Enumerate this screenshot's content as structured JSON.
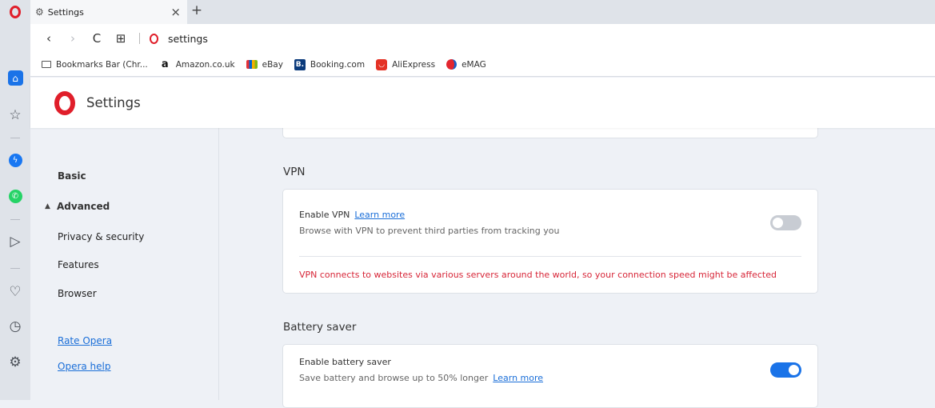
{
  "browser": {
    "tab_title": "Settings",
    "address": "settings",
    "close_glyph": "×",
    "newtab_glyph": "+"
  },
  "nav_buttons": {
    "back": "‹",
    "forward": "›",
    "reload": "C",
    "grid": "⊞"
  },
  "bookmarks": [
    {
      "label": "Bookmarks Bar (Chr...",
      "icon": "folder-icon"
    },
    {
      "label": "Amazon.co.uk",
      "icon": "amazon-icon"
    },
    {
      "label": "eBay",
      "icon": "ebay-icon"
    },
    {
      "label": "Booking.com",
      "icon": "booking-icon"
    },
    {
      "label": "AliExpress",
      "icon": "aliexpress-icon"
    },
    {
      "label": "eMAG",
      "icon": "emag-icon"
    }
  ],
  "settings": {
    "title": "Settings"
  },
  "leftnav": {
    "basic": "Basic",
    "advanced": "Advanced",
    "items": [
      "Privacy & security",
      "Features",
      "Browser"
    ],
    "rate": "Rate Opera",
    "help": "Opera help"
  },
  "vpn": {
    "heading": "VPN",
    "enable_label": "Enable VPN",
    "learn_more": "Learn more",
    "description": "Browse with VPN to prevent third parties from tracking you",
    "warning": "VPN connects to websites via various servers around the world, so your connection speed might be affected",
    "enabled": false
  },
  "battery": {
    "heading": "Battery saver",
    "enable_label": "Enable battery saver",
    "description": "Save battery and browse up to 50% longer",
    "learn_more": "Learn more",
    "enabled": true
  },
  "colors": {
    "accent": "#1a73e8",
    "opera_red": "#e01e2a",
    "warning": "#d72638"
  }
}
